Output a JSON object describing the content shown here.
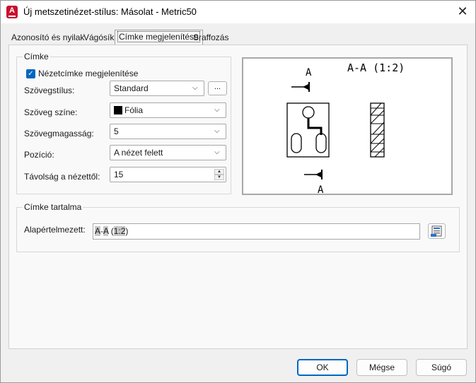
{
  "window": {
    "title": "Új metszetinézet-stílus: Másolat - Metric50",
    "close_glyph": "✕"
  },
  "tabs": [
    {
      "label": "Azonosító és nyilak"
    },
    {
      "label": "Vágósík"
    },
    {
      "label": "Címke megjelenítése",
      "active": true
    },
    {
      "label": "Sraffozás"
    }
  ],
  "label_group": {
    "title": "Címke",
    "show_view_label": {
      "label": "Nézetcímke megjelenítése",
      "checked": true
    },
    "text_style": {
      "label": "Szövegstílus:",
      "value": "Standard",
      "browse_label": "..."
    },
    "text_color": {
      "label": "Szöveg színe:",
      "value": "Fólia",
      "swatch_color": "#000000"
    },
    "text_height": {
      "label": "Szövegmagasság:",
      "value": "5"
    },
    "position": {
      "label": "Pozíció:",
      "value": "A nézet felett"
    },
    "distance": {
      "label": "Távolság a nézettől:",
      "value": "15"
    }
  },
  "preview": {
    "label_a_top": "A",
    "label_a_bottom": "A",
    "view_label": "A-A (1:2)"
  },
  "content_group": {
    "title": "Címke tartalma",
    "default_label": "Alapértelmezett:",
    "value_parts": [
      "A",
      "-",
      "A",
      " (",
      "1:2",
      ")"
    ]
  },
  "buttons": {
    "ok": "OK",
    "cancel": "Mégse",
    "help": "Súgó"
  },
  "colors": {
    "accent": "#0067c0",
    "brand_red": "#c8102e"
  }
}
